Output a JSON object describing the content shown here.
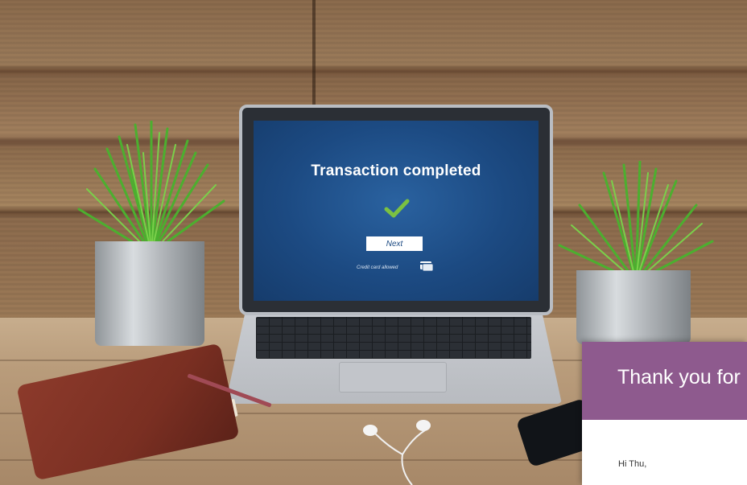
{
  "laptop_screen": {
    "title": "Transaction completed",
    "next_button": "Next",
    "credit_card_note": "Credit card allowed"
  },
  "email": {
    "header": "Thank you for",
    "greeting": "Hi Thu,"
  },
  "icons": {
    "checkmark": "check-icon",
    "credit_card": "credit-card-icon"
  },
  "colors": {
    "screen_blue": "#1c4a82",
    "check_green": "#7bc142",
    "email_header": "#8e5a8e"
  }
}
